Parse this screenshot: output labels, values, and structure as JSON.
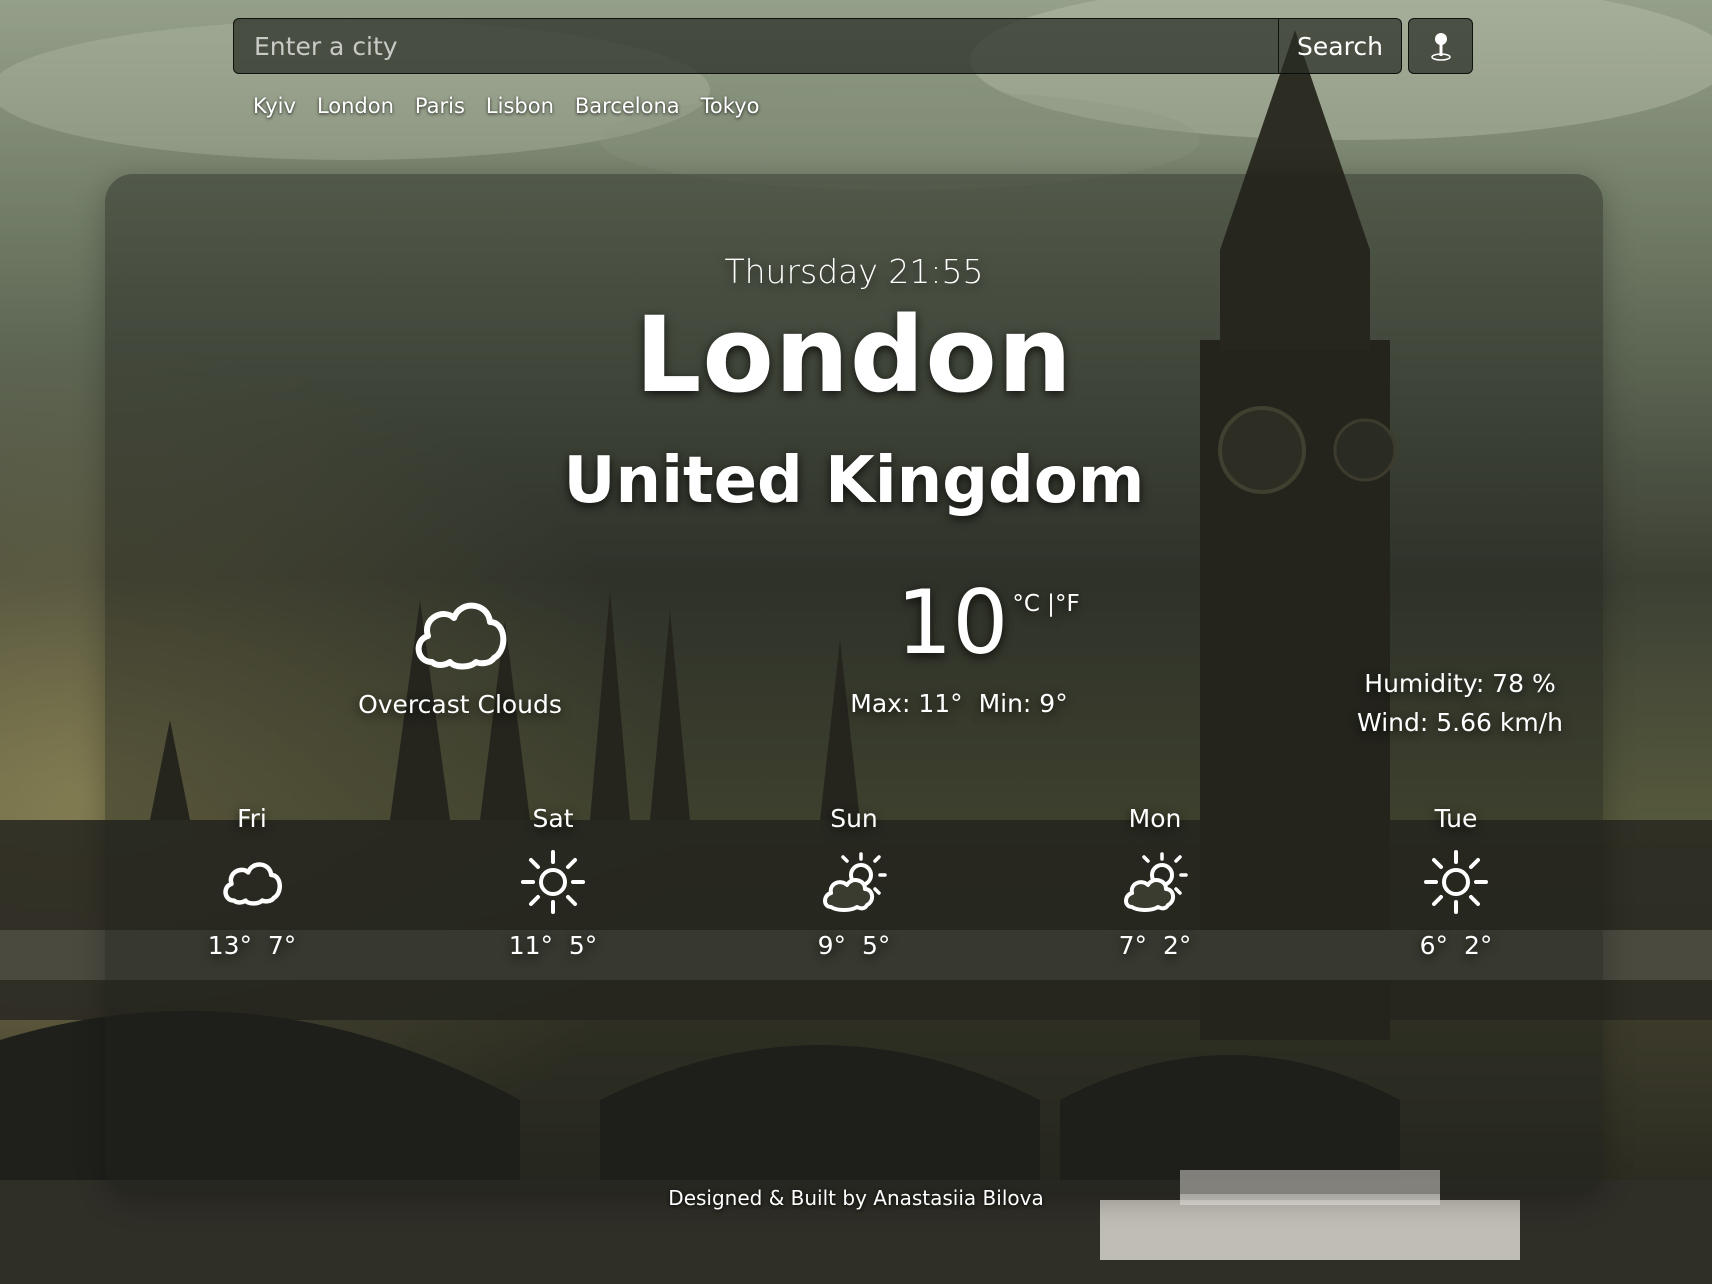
{
  "search": {
    "placeholder": "Enter a city",
    "button_label": "Search"
  },
  "quick_cities": [
    "Kyiv",
    "London",
    "Paris",
    "Lisbon",
    "Barcelona",
    "Tokyo"
  ],
  "current": {
    "datetime": "Thursday 21:55",
    "city": "London",
    "country": "United Kingdom",
    "condition": "Overcast Clouds",
    "condition_icon": "cloud-icon",
    "temperature": "10",
    "unit_c": "°C",
    "unit_sep": " |",
    "unit_f": "°F",
    "max": "Max: 11°",
    "min": "Min: 9°",
    "humidity": "Humidity: 78 %",
    "wind": "Wind: 5.66 km/h"
  },
  "forecast": [
    {
      "day": "Fri",
      "icon": "cloud-icon",
      "max": "13°",
      "min": "7°"
    },
    {
      "day": "Sat",
      "icon": "sun-icon",
      "max": "11°",
      "min": "5°"
    },
    {
      "day": "Sun",
      "icon": "partly-cloudy-icon",
      "max": "9°",
      "min": "5°"
    },
    {
      "day": "Mon",
      "icon": "partly-cloudy-icon",
      "max": "7°",
      "min": "2°"
    },
    {
      "day": "Tue",
      "icon": "sun-icon",
      "max": "6°",
      "min": "2°"
    }
  ],
  "footer": "Designed & Built by Anastasiia Bilova",
  "colors": {
    "card_bg": "#1c1e1a",
    "text": "#ffffff",
    "sky": "#8f9a80"
  }
}
